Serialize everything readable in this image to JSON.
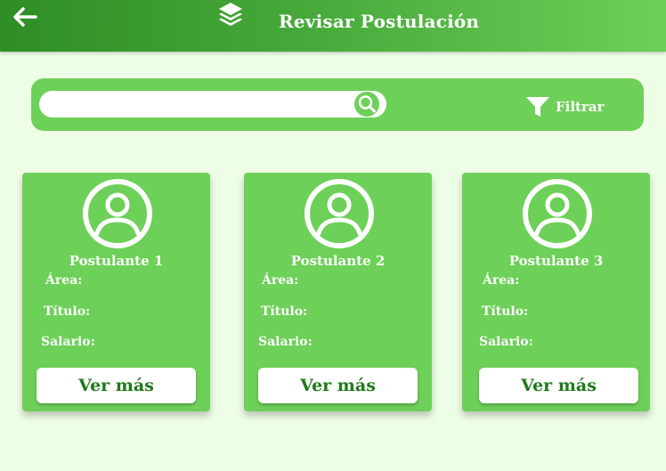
{
  "header": {
    "back_icon": "arrow-left-icon",
    "app_icon": "layers-icon",
    "title": "Revisar Postulación"
  },
  "toolbar": {
    "search": {
      "value": "",
      "placeholder": "",
      "button_icon": "search-icon"
    },
    "filter": {
      "icon": "filter-funnel-icon",
      "label": "Filtrar"
    }
  },
  "colors": {
    "background": "#eefde6",
    "primary_green": "#6dd058",
    "dark_green": "#2e8d26",
    "button_text": "#1f7a1a"
  },
  "applicants": [
    {
      "name": "Postulante 1",
      "area_label": "Área:",
      "titulo_label": "Título:",
      "salario_label": "Salario:",
      "button_label": "Ver más",
      "avatar_icon": "user-circle-icon"
    },
    {
      "name": "Postulante 2",
      "area_label": "Área:",
      "titulo_label": "Título:",
      "salario_label": "Salario:",
      "button_label": "Ver más",
      "avatar_icon": "user-circle-icon"
    },
    {
      "name": "Postulante 3",
      "area_label": "Área:",
      "titulo_label": "Título:",
      "salario_label": "Salario:",
      "button_label": "Ver más",
      "avatar_icon": "user-circle-icon"
    }
  ]
}
